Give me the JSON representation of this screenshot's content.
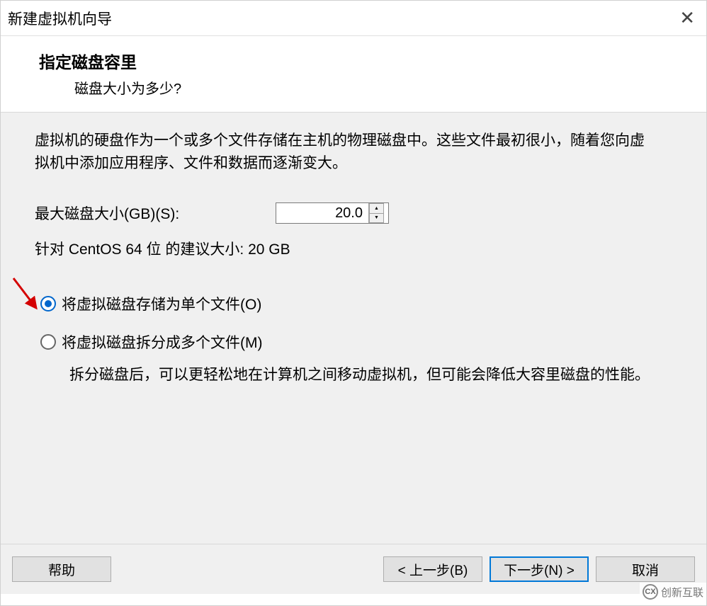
{
  "window": {
    "title": "新建虚拟机向导"
  },
  "header": {
    "heading": "指定磁盘容里",
    "subtitle": "磁盘大小为多少?"
  },
  "intro": "虚拟机的硬盘作为一个或多个文件存储在主机的物理磁盘中。这些文件最初很小，随着您向虚拟机中添加应用程序、文件和数据而逐渐变大。",
  "size": {
    "label": "最大磁盘大小(GB)(S):",
    "value": "20.0"
  },
  "recommend": "针对 CentOS 64 位 的建议大小: 20 GB",
  "radios": {
    "single": "将虚拟磁盘存储为单个文件(O)",
    "split": "将虚拟磁盘拆分成多个文件(M)",
    "split_desc": "拆分磁盘后，可以更轻松地在计算机之间移动虚拟机，但可能会降低大容里磁盘的性能。"
  },
  "buttons": {
    "help": "帮助",
    "back": "< 上一步(B)",
    "next": "下一步(N) >",
    "cancel": "取消"
  },
  "watermark": "创新互联"
}
